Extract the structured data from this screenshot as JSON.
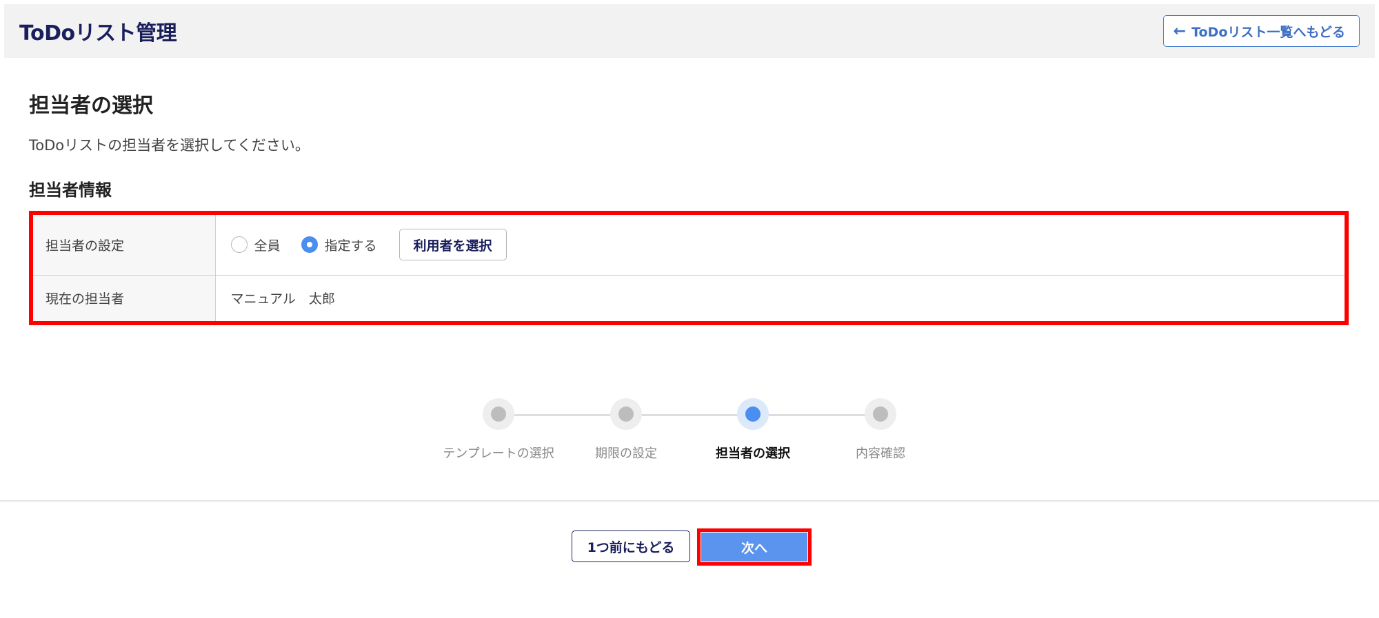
{
  "header": {
    "app_title": "ToDoリスト管理",
    "back_link_label": "ToDoリスト一覧へもどる",
    "back_icon": "arrow-left-icon"
  },
  "main": {
    "page_title": "担当者の選択",
    "description": "ToDoリストの担当者を選択してください。",
    "section_title": "担当者情報",
    "table": {
      "assignee_setting_label": "担当者の設定",
      "radio_all_label": "全員",
      "radio_specify_label": "指定する",
      "selected_option": "指定する",
      "select_user_button": "利用者を選択",
      "current_assignee_label": "現在の担当者",
      "current_assignee_value": "マニュアル　太郎"
    }
  },
  "stepper": {
    "steps": [
      {
        "label": "テンプレートの選択",
        "active": false
      },
      {
        "label": "期限の設定",
        "active": false
      },
      {
        "label": "担当者の選択",
        "active": true
      },
      {
        "label": "内容確認",
        "active": false
      }
    ]
  },
  "footer": {
    "prev_button": "1つ前にもどる",
    "next_button": "次へ"
  },
  "colors": {
    "brand_navy": "#1a1f5c",
    "accent_blue": "#4a8ef0",
    "highlight_red": "#ff0000"
  }
}
